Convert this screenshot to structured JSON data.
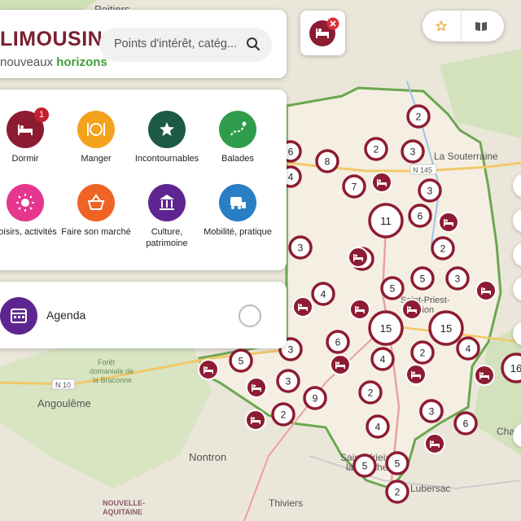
{
  "header": {
    "logo_text": "LIMOUSIN",
    "logo_subtitle_start": "nouveaux ",
    "logo_subtitle_accent": "horizons"
  },
  "search": {
    "placeholder": "Points d'intérêt, catég..."
  },
  "colors": {
    "cluster": "#8d1c32",
    "dormir": "#8d1c32",
    "manger": "#f4a21b",
    "incontournables": "#1d5a45",
    "balades": "#2f9c4c",
    "loisirs": "#e5378f",
    "marche": "#ef6324",
    "culture": "#5e2591",
    "mobilite": "#2a7ec3",
    "agenda": "#5e2591",
    "accent_green": "#3f9d3a"
  },
  "categories": [
    {
      "label": "Dormir",
      "icon": "bed-icon",
      "badge": "1"
    },
    {
      "label": "Manger",
      "icon": "plate-cutlery-icon"
    },
    {
      "label": "Incontournables",
      "icon": "star-map-icon"
    },
    {
      "label": "Balades",
      "icon": "walking-route-icon"
    },
    {
      "label": "Loisirs, activités",
      "icon": "sun-icon"
    },
    {
      "label": "Faire son marché",
      "icon": "basket-icon"
    },
    {
      "label": "Culture, patrimoine",
      "icon": "museum-icon"
    },
    {
      "label": "Mobilité, pratique",
      "icon": "bus-icon"
    }
  ],
  "agenda": {
    "label": "Agenda",
    "icon": "calendar-icon"
  },
  "map": {
    "place_labels": [
      "Poitiers",
      "La Souterraine",
      "N 145",
      "Saint-Priest-",
      "Taurion",
      "Forêt",
      "domaniale de",
      "la Braconne",
      "N 10",
      "Angoulême",
      "Nontron",
      "Saint-Yrieix-",
      "la-Perche",
      "Lubersac",
      "Thiviers",
      "Cham",
      "NOUVELLE-",
      "AQUITAINE"
    ],
    "clusters": [
      "2",
      "6",
      "2",
      "3",
      "8",
      "4",
      "7",
      "3",
      "11",
      "6",
      "3",
      "2",
      "2",
      "5",
      "3",
      "4",
      "5",
      "15",
      "15",
      "6",
      "2",
      "4",
      "3",
      "4",
      "16",
      "5",
      "3",
      "3",
      "9",
      "2",
      "2",
      "3",
      "6",
      "4",
      "5",
      "5",
      "2"
    ]
  }
}
